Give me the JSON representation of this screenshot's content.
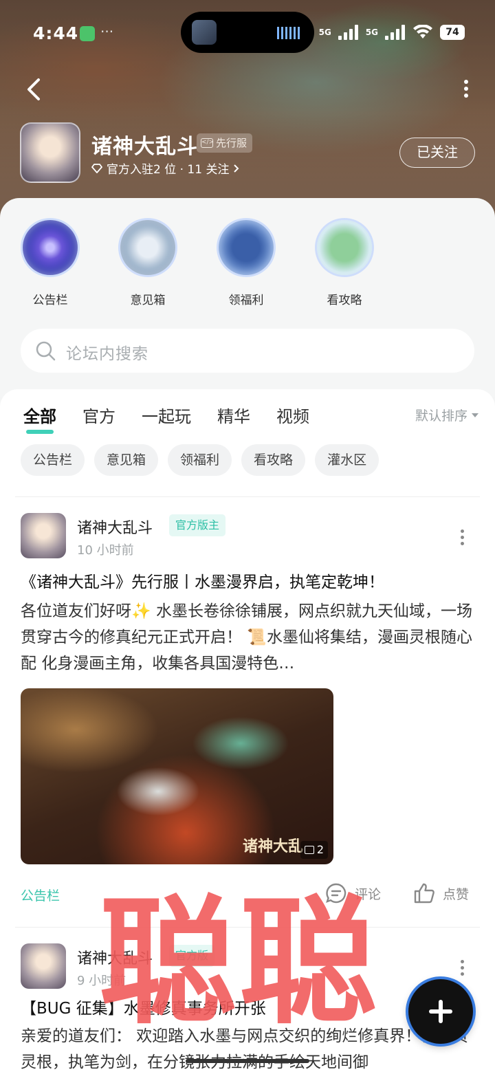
{
  "status": {
    "time": "4:44",
    "battery": "74",
    "network1": "5G",
    "network2": "5G"
  },
  "header": {
    "title": "诸神大乱斗",
    "tag": "先行服",
    "meta": "官方入驻2 位 · 11 关注",
    "follow_label": "已关注"
  },
  "entries": [
    {
      "label": "公告栏",
      "icon": "galaxy-orb-icon"
    },
    {
      "label": "意见箱",
      "icon": "scroll-orb-icon"
    },
    {
      "label": "领福利",
      "icon": "flag-orb-icon"
    },
    {
      "label": "看攻略",
      "icon": "leaf-orb-icon"
    }
  ],
  "search": {
    "placeholder": "论坛内搜索"
  },
  "tabs": [
    {
      "label": "全部",
      "active": true
    },
    {
      "label": "官方",
      "active": false
    },
    {
      "label": "一起玩",
      "active": false
    },
    {
      "label": "精华",
      "active": false
    },
    {
      "label": "视频",
      "active": false
    }
  ],
  "sort_label": "默认排序",
  "chips": [
    "公告栏",
    "意见箱",
    "领福利",
    "看攻略",
    "灌水区"
  ],
  "posts": [
    {
      "author": "诸神大乱斗",
      "tag": "官方版主",
      "time": "10 小时前",
      "title": "《诸神大乱斗》先行服丨水墨漫界启，执笔定乾坤！",
      "body": "各位道友们好呀✨ 水墨长卷徐徐铺展，网点织就九天仙域，一场贯穿古今的修真纪元正式开启！ 📜水墨仙将集结，漫画灵根随心配 化身漫画主角，收集各具国漫特色…",
      "image_watermark": "诸神大乱",
      "image_count": "2",
      "board": "公告栏",
      "comment_label": "评论",
      "like_label": "点赞"
    },
    {
      "author": "诸神大乱斗",
      "tag": "官方版",
      "time": "9 小时前",
      "title": "【BUG 征集】水墨修真事务所开张",
      "body": "亲爱的道友们： 欢迎踏入水墨与网点交织的绚烂修真界！你身负灵根，执笔为剑，在分镜张力拉满的手绘天地间御"
    }
  ],
  "overlay_text": "聪聪"
}
